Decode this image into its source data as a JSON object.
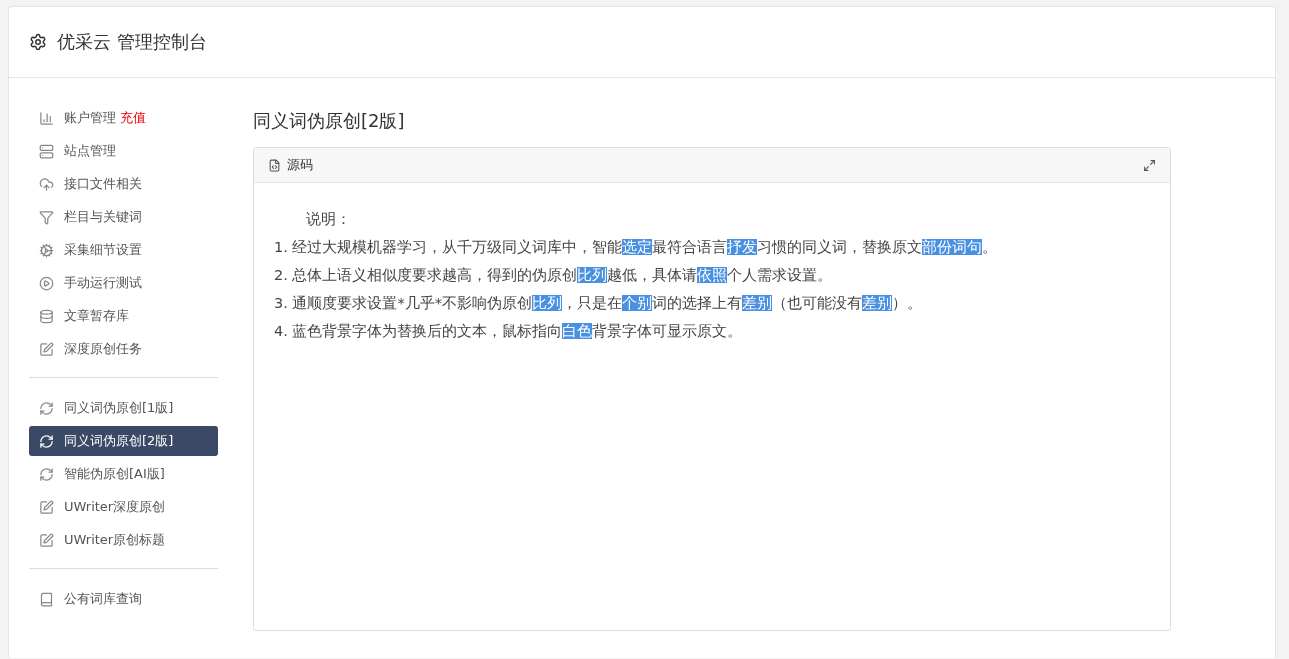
{
  "header": {
    "title": "优采云 管理控制台"
  },
  "sidebar": {
    "groups": [
      {
        "items": [
          {
            "label": "账户管理",
            "badge": "充值",
            "selected": false
          },
          {
            "label": "站点管理",
            "selected": false
          },
          {
            "label": "接口文件相关",
            "selected": false
          },
          {
            "label": "栏目与关键词",
            "selected": false
          },
          {
            "label": "采集细节设置",
            "selected": false
          },
          {
            "label": "手动运行测试",
            "selected": false
          },
          {
            "label": "文章暂存库",
            "selected": false
          },
          {
            "label": "深度原创任务",
            "selected": false
          }
        ]
      },
      {
        "items": [
          {
            "label": "同义词伪原创[1版]",
            "selected": false
          },
          {
            "label": "同义词伪原创[2版]",
            "selected": true
          },
          {
            "label": "智能伪原创[AI版]",
            "selected": false
          },
          {
            "label": "UWriter深度原创",
            "selected": false
          },
          {
            "label": "UWriter原创标题",
            "selected": false
          }
        ]
      },
      {
        "items": [
          {
            "label": "公有词库查询",
            "selected": false
          }
        ]
      }
    ]
  },
  "page_title": "同义词伪原创[2版]",
  "panel": {
    "title": "源码",
    "heading": "说明：",
    "lines": [
      [
        {
          "text": "1. 经过大规模机器学习，从千万级同义词库中，智能",
          "highlighted": false
        },
        {
          "text": "选定",
          "highlighted": true
        },
        {
          "text": "最符合语言",
          "highlighted": false
        },
        {
          "text": "抒发",
          "highlighted": true
        },
        {
          "text": "习惯的同义词，替换原文",
          "highlighted": false
        },
        {
          "text": "部份",
          "highlighted": true
        },
        {
          "text": "词句",
          "highlighted": true
        },
        {
          "text": "。",
          "highlighted": false
        }
      ],
      [
        {
          "text": "2. 总体上语义相似度要求越高，得到的伪原创",
          "highlighted": false
        },
        {
          "text": "比列",
          "highlighted": true
        },
        {
          "text": "越低，具体请",
          "highlighted": false
        },
        {
          "text": "依照",
          "highlighted": true
        },
        {
          "text": "个人需求设置。",
          "highlighted": false
        }
      ],
      [
        {
          "text": "3. 通顺度要求设置*几乎*不影响伪原创",
          "highlighted": false
        },
        {
          "text": "比列",
          "highlighted": true
        },
        {
          "text": "，只是在",
          "highlighted": false
        },
        {
          "text": "个别",
          "highlighted": true
        },
        {
          "text": "词的选择上有",
          "highlighted": false
        },
        {
          "text": "差别",
          "highlighted": true
        },
        {
          "text": "（也可能没有",
          "highlighted": false
        },
        {
          "text": "差别",
          "highlighted": true
        },
        {
          "text": "）。",
          "highlighted": false
        }
      ],
      [
        {
          "text": "4. 蓝色背景字体为替换后的文本，鼠标指向",
          "highlighted": false
        },
        {
          "text": "白色",
          "highlighted": true
        },
        {
          "text": "背景字体可显示原文。",
          "highlighted": false
        }
      ]
    ]
  }
}
